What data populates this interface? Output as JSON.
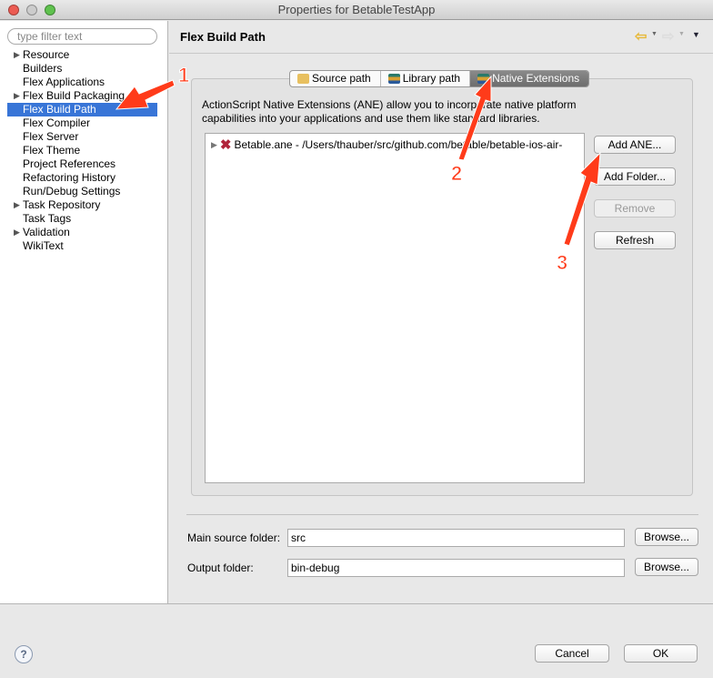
{
  "window": {
    "title": "Properties for BetableTestApp"
  },
  "sidebar": {
    "filter_placeholder": "type filter text",
    "items": [
      {
        "label": "Resource",
        "expandable": true
      },
      {
        "label": "Builders"
      },
      {
        "label": "Flex Applications"
      },
      {
        "label": "Flex Build Packaging",
        "expandable": true
      },
      {
        "label": "Flex Build Path",
        "selected": true
      },
      {
        "label": "Flex Compiler"
      },
      {
        "label": "Flex Server"
      },
      {
        "label": "Flex Theme"
      },
      {
        "label": "Project References"
      },
      {
        "label": "Refactoring History"
      },
      {
        "label": "Run/Debug Settings"
      },
      {
        "label": "Task Repository",
        "expandable": true
      },
      {
        "label": "Task Tags"
      },
      {
        "label": "Validation",
        "expandable": true
      },
      {
        "label": "WikiText"
      }
    ]
  },
  "header": {
    "title": "Flex Build Path",
    "icons": [
      "back-arrow-icon",
      "forward-arrow-icon",
      "menu-dropdown-icon"
    ]
  },
  "tabs": [
    {
      "label": "Source path"
    },
    {
      "label": "Library path"
    },
    {
      "label": "Native Extensions",
      "active": true
    }
  ],
  "native_extensions": {
    "description": "ActionScript Native Extensions (ANE) allow you to incorporate native platform capabilities into your applications and use them like standard libraries.",
    "items": [
      {
        "label": "Betable.ane - /Users/thauber/src/github.com/betable/betable-ios-air-",
        "status": "error"
      }
    ],
    "buttons": {
      "add_ane": "Add ANE...",
      "add_folder": "Add Folder...",
      "remove": "Remove",
      "refresh": "Refresh"
    }
  },
  "fields": {
    "main_source_label": "Main source folder:",
    "main_source_value": "src",
    "output_label": "Output folder:",
    "output_value": "bin-debug",
    "browse": "Browse..."
  },
  "footer": {
    "cancel": "Cancel",
    "ok": "OK"
  },
  "annotations": {
    "one": "1",
    "two": "2",
    "three": "3",
    "color": "#ff3b1a"
  }
}
